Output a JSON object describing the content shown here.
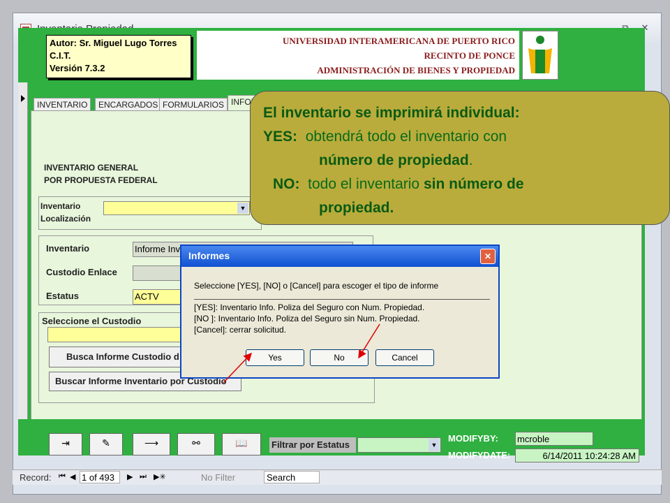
{
  "window": {
    "title": "Inventario Propiedad"
  },
  "info_box": {
    "line1": "Autor:  Sr. Miguel Lugo Torres",
    "line2": "C.I.T.",
    "line3": "Versión 7.3.2"
  },
  "header": {
    "line1": "UNIVERSIDAD INTERAMERICANA DE PUERTO RICO",
    "line2": "RECINTO DE PONCE",
    "line3": "ADMINISTRACIÓN DE BIENES Y PROPIEDAD"
  },
  "tabs": [
    "INVENTARIO",
    "ENCARGADOS",
    "FORMULARIOS",
    "INFOR"
  ],
  "section1": {
    "line1": "INVENTARIO GENERAL",
    "line2": "POR PROPUESTA FEDERAL"
  },
  "inv_loc": {
    "label1": "Inventario",
    "label2": "Localización"
  },
  "fields": {
    "inventario_label": "Inventario",
    "inventario_value": "Informe Inv",
    "custodio_label": "Custodio Enlace",
    "estatus_label": "Estatus",
    "estatus_value": "ACTV"
  },
  "custodio_section": {
    "title": "Seleccione el Custodio",
    "btn1": "Busca Informe Custodio d",
    "btn2": "Buscar Informe Inventario por Custodio"
  },
  "filter": {
    "label": "Filtrar por Estatus"
  },
  "modify": {
    "by_label": "MODIFYBY:",
    "by_value": "mcroble",
    "date_label": "MODIFYDATE:",
    "date_value": "6/14/2011 10:24:28 AM"
  },
  "status": {
    "record_label": "Record:",
    "position": "1 of 493",
    "no_filter": "No Filter",
    "search": "Search"
  },
  "dialog": {
    "title": "Informes",
    "prompt": "Seleccione [YES], [NO] o [Cancel] para escoger el tipo de informe",
    "line1": "[YES]: Inventario Info. Poliza del Seguro con Num. Propiedad.",
    "line2": "[NO ]: Inventario Info. Poliza del Seguro sin Num. Propiedad.",
    "line3": "[Cancel]: cerrar solicitud.",
    "yes": "Yes",
    "no": "No",
    "cancel": "Cancel"
  },
  "callout": {
    "l1": "El inventario se imprimirá individual:",
    "l2a": "YES:",
    "l2b": "obtendrá todo el inventario con",
    "l3a": "número de propiedad",
    "l3b": ".",
    "l4a": "NO:",
    "l4b": "todo el inventario",
    "l4c": "sin número de",
    "l5": "propiedad."
  },
  "colors": {
    "form_green": "#2fb040",
    "callout": "#b9ac3c",
    "callout_text": "#0a6a18",
    "header_red": "#8b1c1c"
  },
  "icons": [
    "form-icon",
    "minimize-icon",
    "restore-icon",
    "close-icon",
    "exit-icon",
    "edit-icon",
    "find-next-icon",
    "binoculars-icon",
    "book-icon"
  ]
}
